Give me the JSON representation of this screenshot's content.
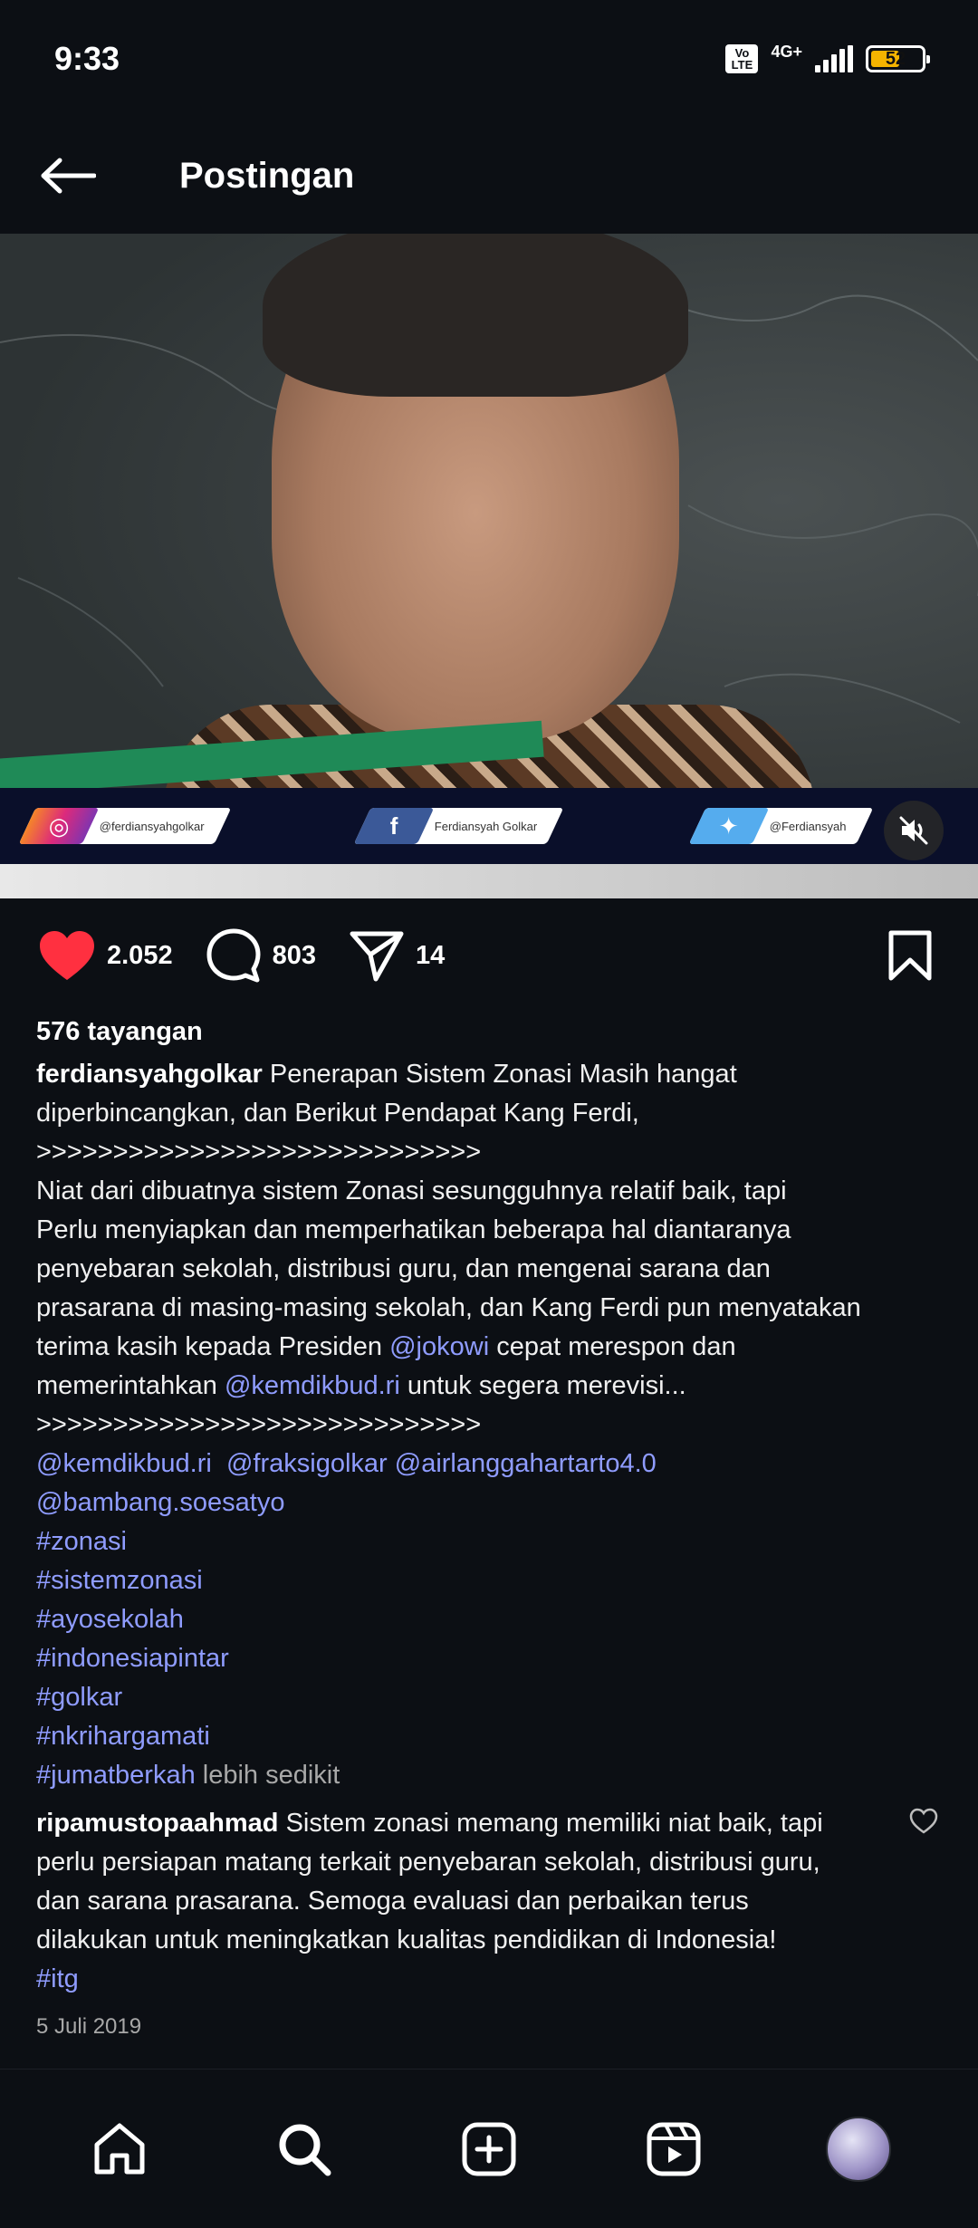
{
  "status_bar": {
    "time": "9:33",
    "volte": "Vo LTE",
    "network": "4G+",
    "battery": "52"
  },
  "header": {
    "title": "Postingan"
  },
  "media": {
    "overlay": {
      "instagram": "@ferdiansyahgolkar",
      "facebook": "Ferdiansyah Golkar",
      "twitter": "@Ferdiansyah"
    }
  },
  "actions": {
    "likes": "2.052",
    "comments": "803",
    "shares": "14"
  },
  "post": {
    "views": "576 tayangan",
    "username": "ferdiansyahgolkar",
    "caption_line1_rest": "Penerapan Sistem Zonasi Masih hangat",
    "caption_line2": "diperbincangkan, dan Berikut Pendapat Kang Ferdi,",
    "separator": ">>>>>>>>>>>>>>>>>>>>>>>>>>>>>",
    "body_line1": "Niat dari dibuatnya sistem Zonasi sesungguhnya relatif baik, tapi",
    "body_line2": "Perlu menyiapkan dan memperhatikan beberapa hal diantaranya",
    "body_line3": "penyebaran sekolah, distribusi guru, dan mengenai sarana dan",
    "body_line4": "prasarana di masing-masing sekolah, dan Kang Ferdi pun menyatakan",
    "body_line5_pre": "terima kasih kepada Presiden ",
    "mention_jokowi": "@jokowi",
    "body_line5_post": " cepat merespon dan",
    "body_line6_pre": "memerintahkan ",
    "mention_kemdikbud": "@kemdikbud.ri",
    "body_line6_post": " untuk segera merevisi...",
    "mentions": [
      "@kemdikbud.ri",
      "@fraksigolkar",
      "@airlanggahartarto4.0",
      "@bambang.soesatyo"
    ],
    "hashtags": [
      "#zonasi",
      "#sistemzonasi",
      "#ayosekolah",
      "#indonesiapintar",
      "#golkar",
      "#nkrihargamati",
      "#jumatberkah"
    ],
    "less_label": "lebih sedikit",
    "date": "5 Juli 2019"
  },
  "comment": {
    "username": "ripamustopaahmad",
    "line1_rest": "Sistem zonasi memang memiliki niat baik, tapi",
    "line2": "perlu persiapan matang terkait penyebaran sekolah, distribusi guru,",
    "line3": "dan sarana prasarana. Semoga evaluasi dan perbaikan terus",
    "line4": "dilakukan untuk meningkatkan kualitas pendidikan di Indonesia!",
    "hashtag": "#itg"
  },
  "bottom_nav": {
    "items": [
      "home-icon",
      "search-icon",
      "create-icon",
      "reels-icon",
      "profile-avatar"
    ]
  },
  "colors": {
    "background": "#0c0f14",
    "link": "#8f9cff",
    "like": "#ff3040"
  }
}
